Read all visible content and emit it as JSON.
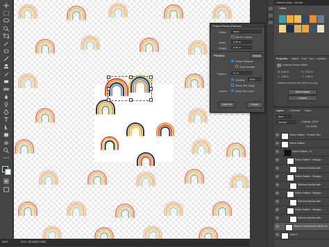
{
  "canvas": {
    "colors": {
      "arc_red": "#e84a32",
      "arc_orange": "#f29a3a",
      "arc_yellow": "#f5c94b",
      "arc_navy": "#1f3552",
      "arc_teal": "#6fa3a8",
      "arc_pink": "#f0a79b",
      "arc_sky": "#8fc6d9"
    }
  },
  "status_bar": {
    "zoom": "50%",
    "doc_size": "Doc: 50.0M/4.08G"
  },
  "pattern_dialog": {
    "title": "Project Panes (Pattern)",
    "offset_label": "Offset",
    "offset_value": "None",
    "mirror_copies_label": "Mirror Copies",
    "width_label": "Width",
    "width_value": "8.00 in",
    "height_label": "Height",
    "height_value": "8.00 in",
    "preview_label": "Preview",
    "refresh_label": "Refresh",
    "show_preview_label": "Show Preview",
    "auto_update_label": "Auto Update",
    "copies_label": "Copies",
    "copies_value": "3 x 3",
    "opacity_label": "Opacity",
    "opacity_value": "60%",
    "show_tile_edge_label": "Show Tile Edge",
    "layers_label": "Layers",
    "wrap_tile_label": "Wrap the Layer",
    "save_as_label": "Save As",
    "export_label": "Export"
  },
  "right_panel": {
    "doc_tabs": [
      "Rainbow Baby - Gender ..."
    ],
    "swatch_header": "Colors",
    "swatches": [
      "#3aa1a6",
      "#f4a93a",
      "#e8c25d",
      "#2e4a6b",
      "#ef8a2e",
      "#6b7f8a",
      "#f7d68a",
      "#1d2f4f",
      "#d6b16a",
      "#f2a33a",
      "#345575",
      "#e7e0c9"
    ],
    "properties_tabs": [
      "Properties",
      "Adjust",
      "Char",
      "Para",
      "Libraries"
    ],
    "properties_title": "Unlinked Smart Object",
    "properties_fields": [
      {
        "label": "W",
        "value": "5.83 in"
      },
      {
        "label": "H",
        "value": "5.14 in"
      },
      {
        "label": "X",
        "value": "1.98 in"
      },
      {
        "label": "Y",
        "value": "0.50 in"
      }
    ],
    "properties_file": "Rainbow Neutral with White Arc.png",
    "edit_contents_label": "Edit Contents",
    "embed_label": "Embed",
    "layers_tabs": [
      "Layers",
      "Channels",
      "Paths"
    ],
    "layers_filter": "Kind",
    "layers_blend": "Normal",
    "layers_opacity": "Opacity: 100%",
    "layers_fill": "Fill: 100%",
    "layers": [
      {
        "name": "Panes Pattern - Preview Grp"
      },
      {
        "name": "Panes Pattern"
      },
      {
        "name": "Panes Pattern - Fr"
      },
      {
        "name": "Panes Pattern - Wrappe..."
      },
      {
        "name": "Rainbow Neutral with..."
      },
      {
        "name": "Panes Pattern - Wrappe..."
      },
      {
        "name": "Rainbow Neutral with..."
      },
      {
        "name": "Panes Pattern - Wrappe..."
      },
      {
        "name": "Rainbow Neutral with..."
      },
      {
        "name": "Panes Pattern - Wrappe..."
      },
      {
        "name": "Rainbow Neutral with..."
      },
      {
        "name": "Rainbow Neutral with White Arc"
      },
      {
        "name": "Layer 0"
      }
    ]
  }
}
